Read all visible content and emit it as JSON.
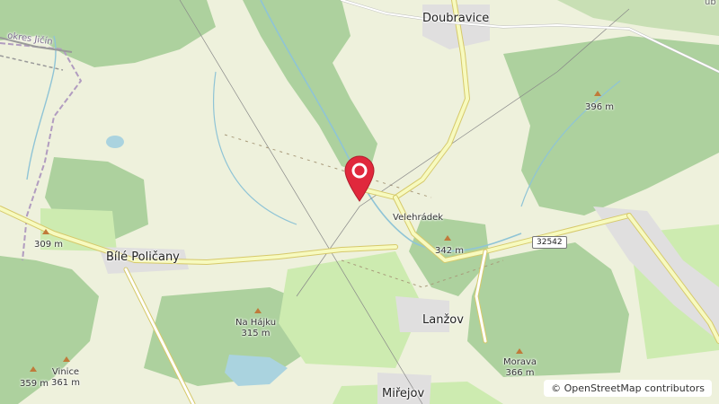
{
  "map": {
    "labels": {
      "doubravice": "Doubravice",
      "okres": "okres Jičín",
      "velehradek": "Velehrádek",
      "bile_policany": "Bílé Poličany",
      "lanzov": "Lanžov",
      "mirejov": "Miřejov",
      "na_hajku": "Na Hájku",
      "na_hajku_elev": "315 m",
      "vinice": "Vinice",
      "vinice_elev": "361 m",
      "morava": "Morava",
      "morava_elev": "366 m",
      "peak_396": "396 m",
      "peak_342": "342 m",
      "peak_309": "309 m",
      "peak_359": "359 m",
      "road_32542": "32542",
      "edge_text": "ub"
    },
    "attribution": {
      "symbol": "©",
      "text": "OpenStreetMap contributors"
    },
    "marker": {
      "color": "#e0283c",
      "icon": "map-pin-icon"
    },
    "colors": {
      "land": "#eef1dc",
      "forest": "#add19e",
      "meadow": "#cdebb0",
      "water": "#aad3df",
      "road_major": "#f7fabf",
      "road_casing": "#d6c96a",
      "residential": "#e0dfdf"
    }
  }
}
